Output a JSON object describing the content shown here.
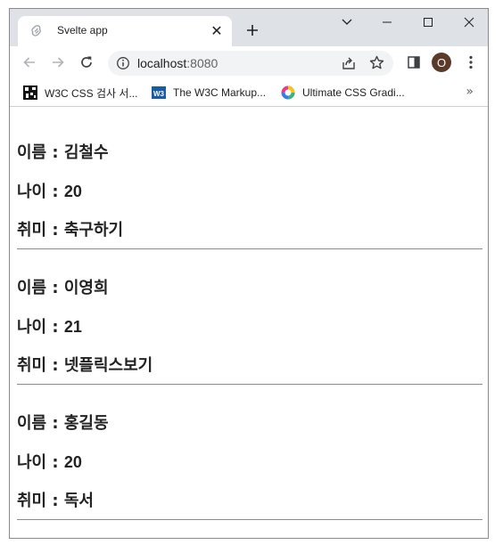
{
  "browser": {
    "tab": {
      "title": "Svelte app",
      "close_glyph": "✕"
    },
    "new_tab_label": "+",
    "address": {
      "host": "localhost",
      "port": ":8080"
    },
    "profile_initial": "O",
    "bookmarks": [
      {
        "label": "W3C CSS 검사 서...",
        "icon": "w3c-qr-icon"
      },
      {
        "label": "The W3C Markup...",
        "icon": "w3c-logo-icon"
      },
      {
        "label": "Ultimate CSS Gradi...",
        "icon": "gradient-wheel-icon"
      }
    ],
    "bookmarks_more": "»"
  },
  "people": [
    {
      "name_label": "이름 : ",
      "name": "김철수",
      "age_label": "나이 : ",
      "age": "20",
      "hobby_label": "취미 : ",
      "hobby": "축구하기"
    },
    {
      "name_label": "이름 : ",
      "name": "이영희",
      "age_label": "나이 : ",
      "age": "21",
      "hobby_label": "취미 : ",
      "hobby": "넷플릭스보기"
    },
    {
      "name_label": "이름 : ",
      "name": "홍길동",
      "age_label": "나이 : ",
      "age": "20",
      "hobby_label": "취미 : ",
      "hobby": "독서"
    }
  ],
  "colors": {
    "tabstrip": "#dee1e6",
    "text": "#222222",
    "divider": "#8a8a8a",
    "profile": "#5b3a29"
  }
}
